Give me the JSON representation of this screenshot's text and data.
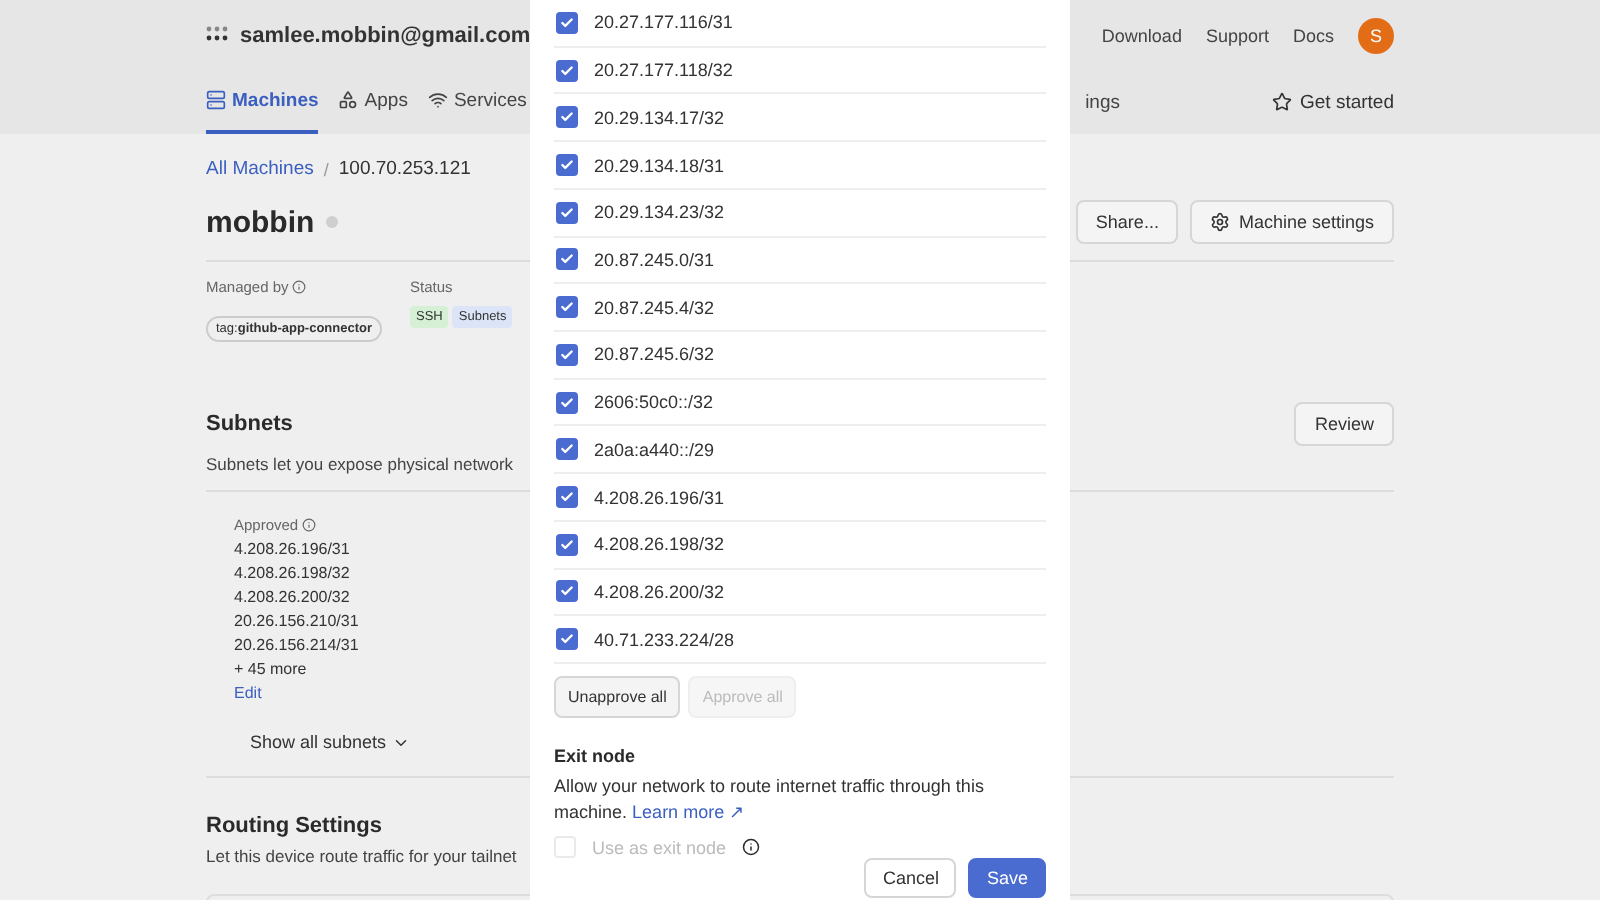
{
  "header": {
    "account": "samlee.mobbin@gmail.com",
    "links": [
      "Download",
      "Support",
      "Docs"
    ],
    "avatar": "S"
  },
  "nav": {
    "tabs": [
      {
        "label": "Machines",
        "selected": true
      },
      {
        "label": "Apps",
        "selected": false
      },
      {
        "label": "Services",
        "selected": false
      }
    ],
    "cut_tab": "ings",
    "get_started": "Get started"
  },
  "breadcrumb": {
    "link": "All Machines",
    "separator": "/",
    "current": "100.70.253.121"
  },
  "machine": {
    "name": "mobbin",
    "online": false,
    "actions": [
      "Share...",
      "Machine settings"
    ]
  },
  "managed_by": {
    "label": "Managed by",
    "tag_prefix": "tag:",
    "tag": "github-app-connector"
  },
  "status": {
    "label": "Status",
    "badges": [
      {
        "label": "SSH",
        "color": "#d6f0d6"
      },
      {
        "label": "Subnets",
        "color": "#dbe5f7"
      }
    ]
  },
  "subnets": {
    "title": "Subnets",
    "description": "Subnets let you expose physical network",
    "review": "Review",
    "approved_label": "Approved",
    "approved": [
      "4.208.26.196/31",
      "4.208.26.198/32",
      "4.208.26.200/32",
      "20.26.156.210/31",
      "20.26.156.214/31"
    ],
    "more": "+ 45 more",
    "edit": "Edit",
    "show_all": "Show all subnets"
  },
  "routing": {
    "title": "Routing Settings",
    "description": "Let this device route traffic for your tailnet"
  },
  "dialog": {
    "subnets": [
      {
        "label": "20.27.177.116/31",
        "checked": true
      },
      {
        "label": "20.27.177.118/32",
        "checked": true
      },
      {
        "label": "20.29.134.17/32",
        "checked": true
      },
      {
        "label": "20.29.134.18/31",
        "checked": true
      },
      {
        "label": "20.29.134.23/32",
        "checked": true
      },
      {
        "label": "20.87.245.0/31",
        "checked": true
      },
      {
        "label": "20.87.245.4/32",
        "checked": true
      },
      {
        "label": "20.87.245.6/32",
        "checked": true
      },
      {
        "label": "2606:50c0::/32",
        "checked": true
      },
      {
        "label": "2a0a:a440::/29",
        "checked": true
      },
      {
        "label": "4.208.26.196/31",
        "checked": true
      },
      {
        "label": "4.208.26.198/32",
        "checked": true
      },
      {
        "label": "4.208.26.200/32",
        "checked": true
      },
      {
        "label": "40.71.233.224/28",
        "checked": true
      }
    ],
    "bulk_buttons": [
      {
        "label": "Unapprove all",
        "disabled": false
      },
      {
        "label": "Approve all",
        "disabled": true
      }
    ],
    "exit_node": {
      "title": "Exit node",
      "description": "Allow your network to route internet traffic through this machine.",
      "link": "Learn more ↗",
      "option": {
        "label": "Use as exit node",
        "checked": false,
        "disabled": true
      }
    },
    "footer": [
      {
        "label": "Cancel",
        "kind": "secondary"
      },
      {
        "label": "Save",
        "kind": "primary"
      }
    ]
  }
}
